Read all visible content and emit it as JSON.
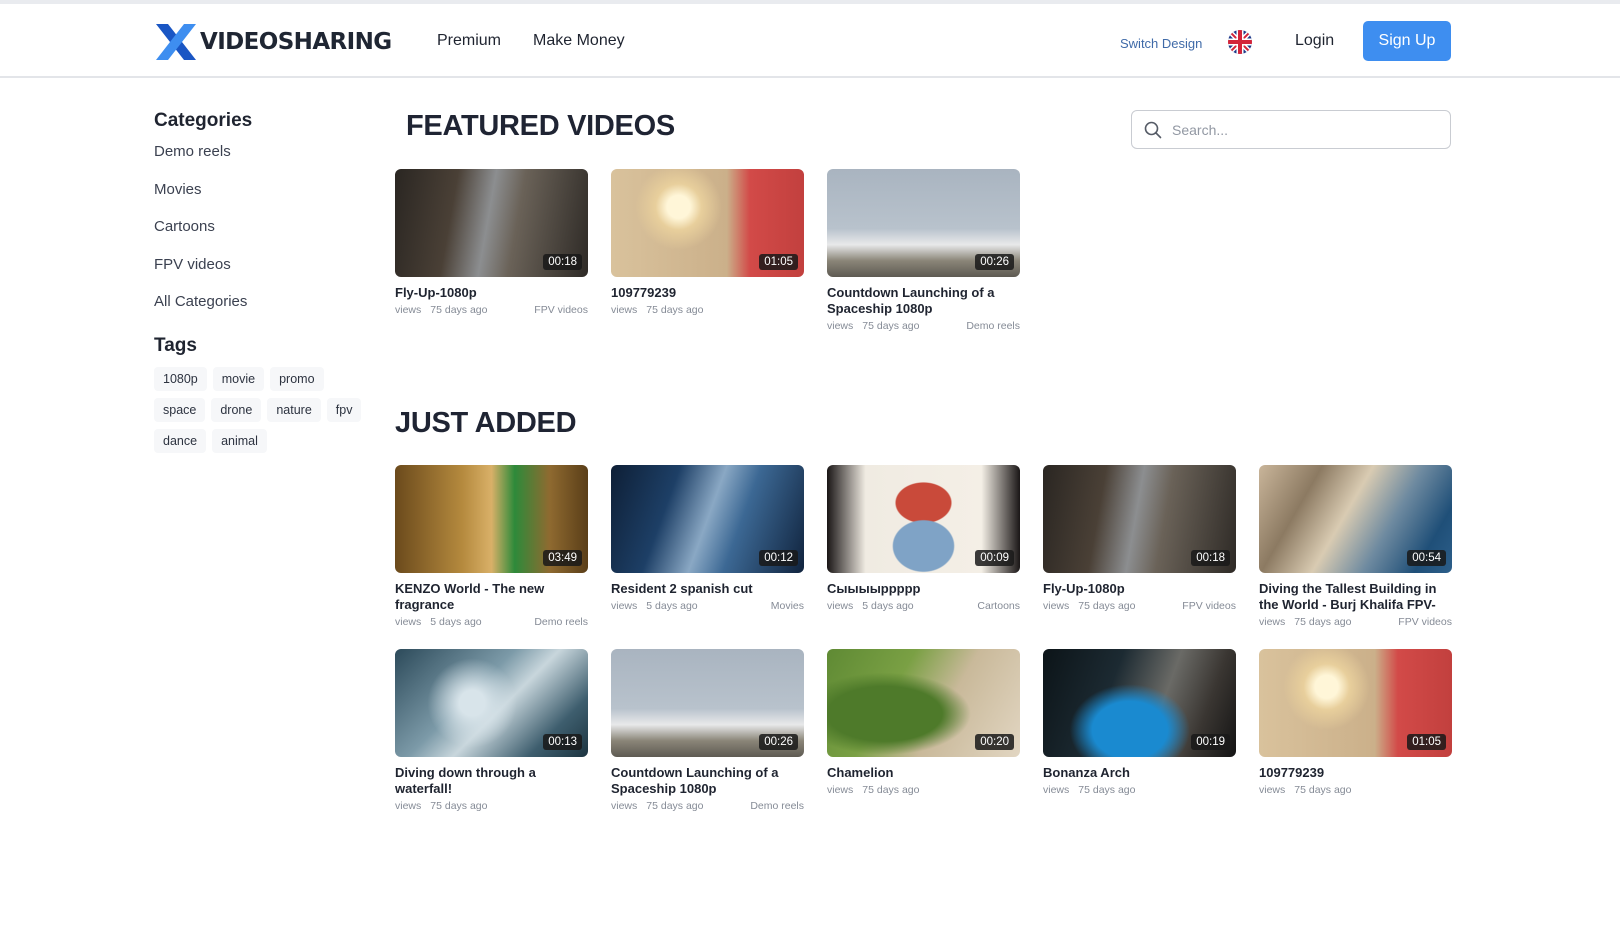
{
  "header": {
    "logo_text": "VIDEOSHARING",
    "nav": [
      "Premium",
      "Make Money"
    ],
    "switch_design": "Switch Design",
    "login": "Login",
    "signup": "Sign Up"
  },
  "sidebar": {
    "categories_title": "Categories",
    "categories": [
      "Demo reels",
      "Movies",
      "Cartoons",
      "FPV videos",
      "All Categories"
    ],
    "tags_title": "Tags",
    "tags": [
      "1080p",
      "movie",
      "promo",
      "space",
      "drone",
      "nature",
      "fpv",
      "dance",
      "animal"
    ]
  },
  "search": {
    "placeholder": "Search..."
  },
  "featured": {
    "title": "FEATURED VIDEOS",
    "videos": [
      {
        "title": "Fly-Up-1080p",
        "duration": "00:18",
        "views": "views",
        "ago": "75 days ago",
        "category": "FPV videos"
      },
      {
        "title": "109779239",
        "duration": "01:05",
        "views": "views",
        "ago": "75 days ago",
        "category": ""
      },
      {
        "title": "Countdown Launching of a Spaceship 1080p",
        "duration": "00:26",
        "views": "views",
        "ago": "75 days ago",
        "category": "Demo reels"
      }
    ]
  },
  "just_added": {
    "title": "JUST ADDED",
    "videos": [
      {
        "title": "KENZO World - The new fragrance",
        "duration": "03:49",
        "views": "views",
        "ago": "5 days ago",
        "category": "Demo reels"
      },
      {
        "title": "Resident 2 spanish cut",
        "duration": "00:12",
        "views": "views",
        "ago": "5 days ago",
        "category": "Movies"
      },
      {
        "title": "Сыыыыррррр",
        "duration": "00:09",
        "views": "views",
        "ago": "5 days ago",
        "category": "Cartoons"
      },
      {
        "title": "Fly-Up-1080p",
        "duration": "00:18",
        "views": "views",
        "ago": "75 days ago",
        "category": "FPV videos"
      },
      {
        "title": "Diving the Tallest Building in the World - Burj Khalifa FPV-",
        "duration": "00:54",
        "views": "views",
        "ago": "75 days ago",
        "category": "FPV videos"
      },
      {
        "title": "Diving down through a waterfall!",
        "duration": "00:13",
        "views": "views",
        "ago": "75 days ago",
        "category": ""
      },
      {
        "title": "Countdown Launching of a Spaceship 1080p",
        "duration": "00:26",
        "views": "views",
        "ago": "75 days ago",
        "category": "Demo reels"
      },
      {
        "title": "Chamelion",
        "duration": "00:20",
        "views": "views",
        "ago": "75 days ago",
        "category": ""
      },
      {
        "title": "Bonanza Arch",
        "duration": "00:19",
        "views": "views",
        "ago": "75 days ago",
        "category": ""
      },
      {
        "title": "109779239",
        "duration": "01:05",
        "views": "views",
        "ago": "75 days ago",
        "category": ""
      }
    ]
  },
  "colors": {
    "accent": "#3e8ef0",
    "logo_blue": "#2f7ce8"
  },
  "icons": {
    "search": "search-icon",
    "flag": "uk-flag-icon"
  }
}
